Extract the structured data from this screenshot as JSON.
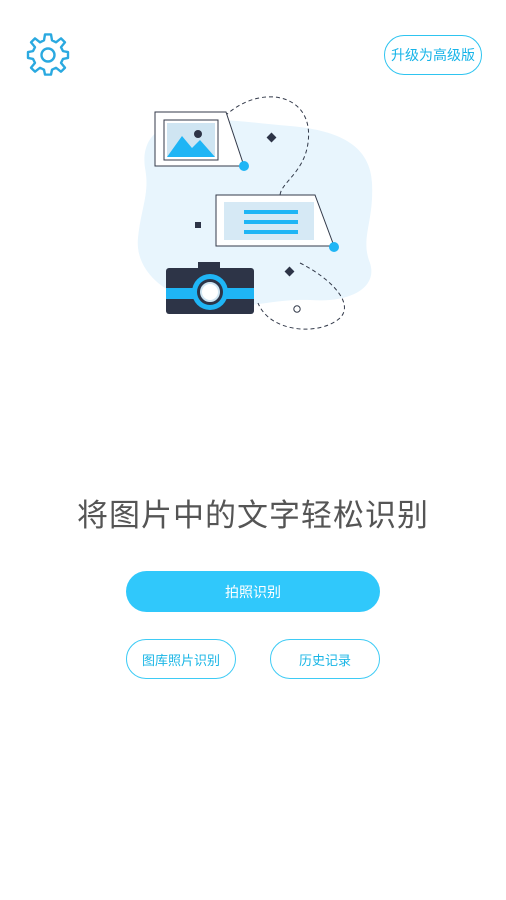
{
  "header": {
    "settings_icon": "gear-icon",
    "upgrade_label": "升级为高级版"
  },
  "hero": {
    "illustration": "photo-text-recognition-illustration",
    "headline": "将图片中的文字轻松识别"
  },
  "actions": {
    "camera_label": "拍照识别",
    "gallery_label": "图库照片识别",
    "history_label": "历史记录"
  },
  "colors": {
    "accent": "#30c8fb",
    "accent_text": "#17b4e8",
    "headline_text": "#555555",
    "illustration_blob": "#e8f5fd",
    "camera_body": "#2d3447"
  }
}
